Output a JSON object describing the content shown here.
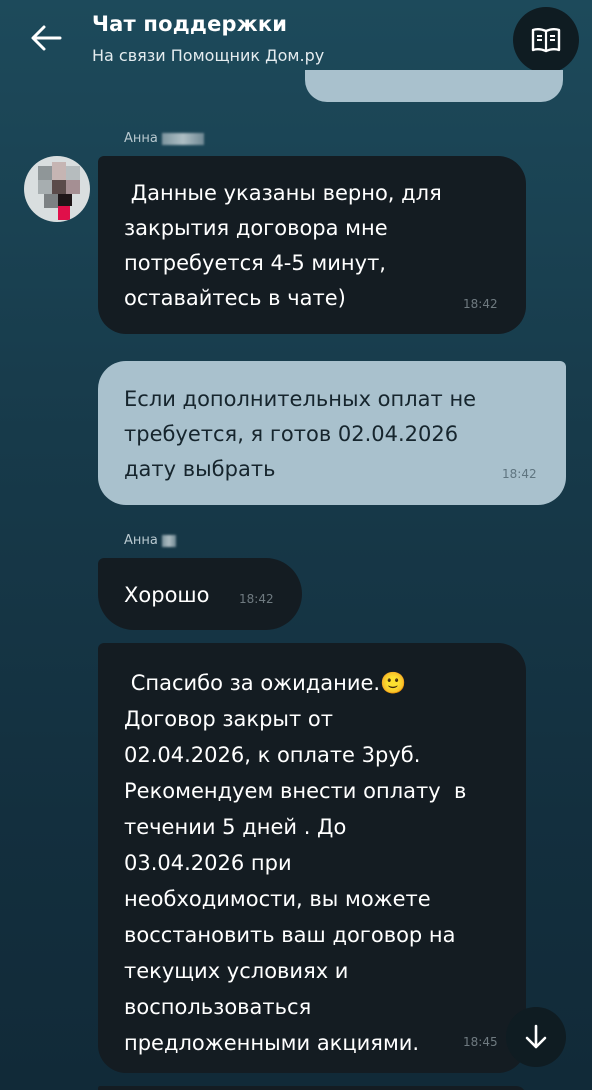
{
  "header": {
    "title": "Чат поддержки",
    "subtitle": "На связи Помощник Дом.ру",
    "back_icon": "arrow-left-icon",
    "book_icon": "book-icon"
  },
  "messages": [
    {
      "sender": "Анна",
      "text": " Данные указаны верно, для\nзакрытия договора мне\nпотребуется 4-5 минут,\nоставайтесь в чате)",
      "time": "18:42"
    },
    {
      "text": "Если дополнительных оплат не\nтребуется, я готов 02.04.2026\nдату выбрать",
      "time": "18:42"
    },
    {
      "sender": "Анна",
      "text": "Хорошо",
      "time": "18:42"
    },
    {
      "text": " Спасибо за ожидание.🙂\nДоговор закрыт от\n02.04.2026, к оплате 3руб.\nРекомендуем внести оплату  в\nтечении 5 дней . До\n03.04.2026 при\nнеобходимости, вы можете\nвосстановить ваш договор на\nтекущих условиях и\nвоспользоваться\nпредложенными акциями.",
      "time": "18:45"
    }
  ],
  "scroll_down_icon": "arrow-down-icon",
  "colors": {
    "background_top": "#1d4a5b",
    "background_bottom": "#112a38",
    "bubble_operator": "#141c22",
    "bubble_user": "#a9c1cd"
  }
}
